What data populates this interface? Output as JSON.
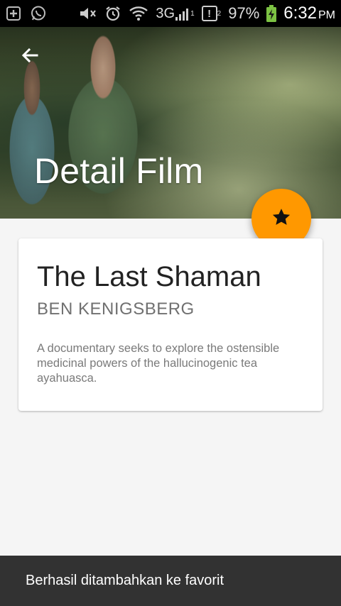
{
  "status_bar": {
    "left_icons": [
      "plus-box-icon",
      "whatsapp-icon"
    ],
    "right_icons": [
      "mute-icon",
      "alarm-icon",
      "wifi-icon"
    ],
    "network": "3G",
    "signal_sup": "1",
    "sim_badge": "!",
    "sim_sup": "2",
    "battery_pct": "97%",
    "time": "6:32",
    "ampm": "PM"
  },
  "header": {
    "title": "Detail Film",
    "back_icon": "arrow-left-icon"
  },
  "fab": {
    "icon": "star-icon",
    "color": "#ff9800"
  },
  "film": {
    "title": "The Last Shaman",
    "director": "BEN KENIGSBERG",
    "description": "A documentary seeks to explore the ostensible medicinal powers of the hallucinogenic tea ayahuasca."
  },
  "snackbar": {
    "message": "Berhasil ditambahkan ke favorit"
  },
  "colors": {
    "accent": "#ff9800",
    "snackbar_bg": "#323232",
    "status_bar_bg": "#000000"
  }
}
